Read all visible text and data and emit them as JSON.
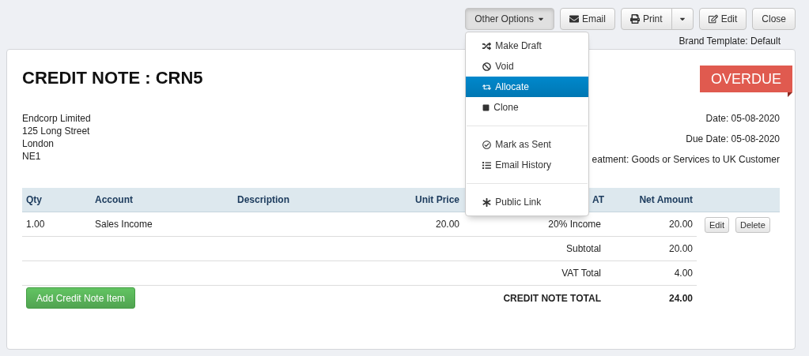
{
  "toolbar": {
    "other_options": {
      "label": "Other Options",
      "expanded": true
    },
    "email": "Email",
    "print": "Print",
    "edit": "Edit",
    "close": "Close"
  },
  "menu": {
    "groups": [
      [
        {
          "label": "Make Draft",
          "selected": false
        },
        {
          "label": "Void",
          "selected": false
        },
        {
          "label": "Allocate",
          "selected": true
        },
        {
          "label": "Clone",
          "selected": false
        }
      ],
      [
        {
          "label": "Mark as Sent",
          "selected": false
        },
        {
          "label": "Email History",
          "selected": false
        }
      ],
      [
        {
          "label": "Public Link",
          "selected": false
        }
      ]
    ]
  },
  "brand_template": "Brand Template: Default",
  "document": {
    "title": "CREDIT NOTE : CRN5",
    "status": "OVERDUE",
    "address": [
      "Endcorp Limited",
      "125 Long Street",
      "London",
      "NE1"
    ],
    "meta": [
      "Date: 05-08-2020",
      "Due Date: 05-08-2020",
      "eatment: Goods or Services to UK Customer"
    ]
  },
  "table": {
    "columns": [
      "Qty",
      "Account",
      "Description",
      "Unit Price",
      "AT",
      "Net Amount"
    ],
    "rows": [
      {
        "qty": "1.00",
        "account": "Sales Income",
        "unit_price": "20.00",
        "vat": "20% Income",
        "net_amount": "20.00",
        "actions": [
          "Edit",
          "Delete"
        ]
      }
    ],
    "totals": [
      {
        "kind": "plain",
        "label": "Subtotal",
        "value": "20.00"
      },
      {
        "kind": "plain",
        "label": "VAT Total",
        "value": "4.00"
      },
      {
        "kind": "grand",
        "label": "CREDIT NOTE TOTAL",
        "value": "24.00"
      }
    ],
    "add_button": "Add Credit Note Item"
  }
}
